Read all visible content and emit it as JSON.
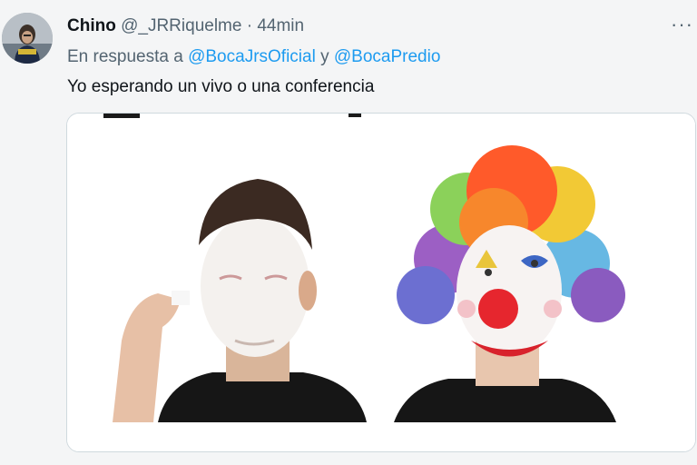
{
  "tweet": {
    "author_name": "Chino",
    "author_handle": "@_JRRiquelme",
    "separator": "·",
    "timestamp": "44min",
    "more_icon": "more-horizontal-icon",
    "reply_prefix": "En respuesta a",
    "mentions": [
      "@BocaJrsOficial",
      "@BocaPredio"
    ],
    "mention_joiner": "y",
    "text": "Yo esperando un vivo o una conferencia"
  },
  "media": {
    "type": "meme-image",
    "panels": [
      "man-applying-white-face-paint",
      "man-in-full-clown-makeup"
    ]
  },
  "colors": {
    "link": "#1d9bf0",
    "secondary_text": "#536471",
    "background": "#f4f5f6"
  }
}
